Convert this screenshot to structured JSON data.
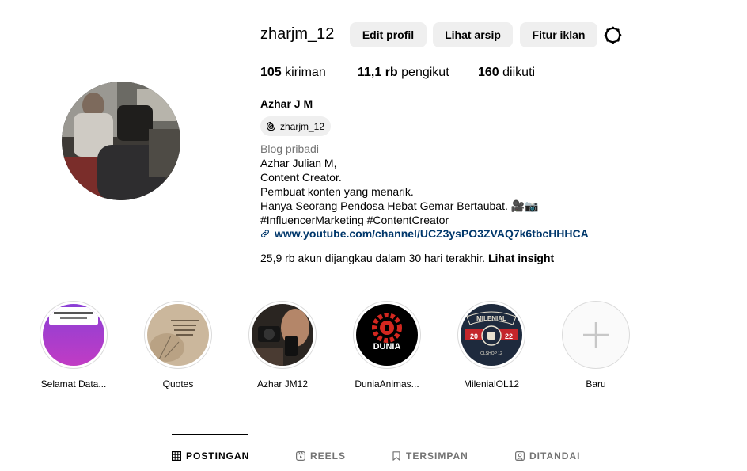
{
  "profile": {
    "username": "zharjm_12",
    "buttons": {
      "edit": "Edit profil",
      "archive": "Lihat arsip",
      "ads": "Fitur iklan"
    },
    "stats": {
      "posts_count": "105",
      "posts_label": "kiriman",
      "followers_count": "11,1 rb",
      "followers_label": "pengikut",
      "following_count": "160",
      "following_label": "diikuti"
    },
    "full_name": "Azhar J M",
    "threads_handle": "zharjm_12",
    "category": "Blog pribadi",
    "bio_lines": [
      "Azhar Julian M,",
      "Content Creator.",
      "Pembuat konten yang menarik.",
      "Hanya Seorang Pendosa Hebat Gemar Bertaubat. 🎥📷",
      "#InfluencerMarketing #ContentCreator"
    ],
    "link": "www.youtube.com/channel/UCZ3ysPO3ZVAQ7k6tbcHHHCA",
    "insight_text": "25,9 rb akun dijangkau dalam 30 hari terakhir.",
    "insight_link": "Lihat insight"
  },
  "highlights": [
    {
      "label": "Selamat Data..."
    },
    {
      "label": "Quotes"
    },
    {
      "label": "Azhar JM12"
    },
    {
      "label": "DuniaAnimas..."
    },
    {
      "label": "MilenialOL12"
    },
    {
      "label": "Baru"
    }
  ],
  "highlight_art": {
    "dunia_text": "DUNIA",
    "milenial_text": "MILENIAL",
    "milenial_left": "20",
    "milenial_right": "22",
    "milenial_sub": "OLSHOP 12"
  },
  "tabs": [
    {
      "label": "POSTINGAN",
      "icon": "grid-icon",
      "active": true
    },
    {
      "label": "REELS",
      "icon": "reels-icon",
      "active": false
    },
    {
      "label": "TERSIMPAN",
      "icon": "bookmark-icon",
      "active": false
    },
    {
      "label": "DITANDAI",
      "icon": "tagged-icon",
      "active": false
    }
  ],
  "colors": {
    "link": "#00376b",
    "button_bg": "#efefef",
    "muted": "#737373",
    "divider": "#dbdbdb"
  }
}
